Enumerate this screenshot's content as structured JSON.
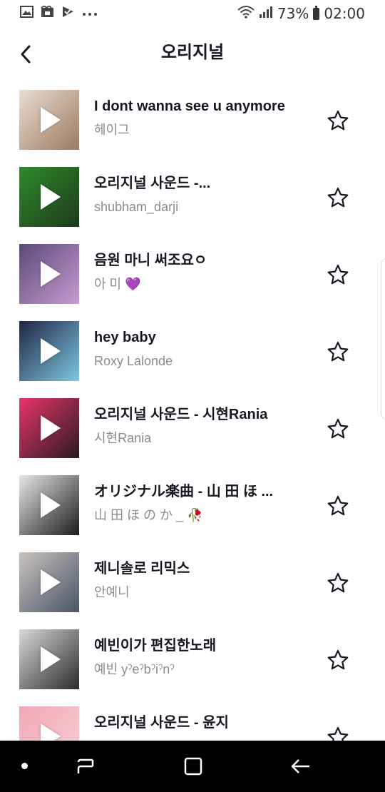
{
  "status_bar": {
    "battery_percent": "73%",
    "time": "02:00",
    "left_icons": [
      "gallery-icon",
      "media-icon",
      "check-icon",
      "more-dots-icon"
    ],
    "right_icons": [
      "wifi-icon",
      "signal-icon",
      "battery-icon"
    ]
  },
  "header": {
    "title": "오리지널"
  },
  "sounds": [
    {
      "title": "I dont wanna see u anymore",
      "author": "헤이그",
      "cover_colors": [
        "#e9ddd2",
        "#9b7b62"
      ]
    },
    {
      "title": "오리지널 사운드 -...",
      "author": "shubham_darji",
      "cover_colors": [
        "#2f8a2a",
        "#1d3a1c"
      ]
    },
    {
      "title": "음원 마니 써조요ㅇ",
      "author": "아 미 💜",
      "cover_colors": [
        "#5b4a7a",
        "#c79bd0"
      ]
    },
    {
      "title": "hey baby",
      "author": "Roxy Lalonde",
      "cover_colors": [
        "#1f2746",
        "#7fc6e0"
      ]
    },
    {
      "title": "오리지널 사운드 - 시현Rania",
      "author": "시현Rania",
      "cover_colors": [
        "#e8356b",
        "#2a1b22"
      ]
    },
    {
      "title": "オリジナル楽曲 - 山 田 ほ ...",
      "author": "山 田 ほ の か _ 🥀",
      "cover_colors": [
        "#e8e6e6",
        "#1c1c1c"
      ]
    },
    {
      "title": "제니솔로 리믹스",
      "author": "안예니",
      "cover_colors": [
        "#c9c3bd",
        "#4a5568"
      ]
    },
    {
      "title": "예빈이가 편집한노래",
      "author": "예빈 yˀeˀbˀiˀnˀ",
      "cover_colors": [
        "#d9d9d9",
        "#2b2b2b"
      ]
    },
    {
      "title": "오리지널 사운드 - 윤지",
      "author": "",
      "cover_colors": [
        "#f1a7b5",
        "#f7d0d6"
      ]
    }
  ],
  "nav_bar": {
    "icons": [
      "nav-dot-icon",
      "recent-apps-icon",
      "home-icon",
      "back-arrow-icon"
    ]
  }
}
